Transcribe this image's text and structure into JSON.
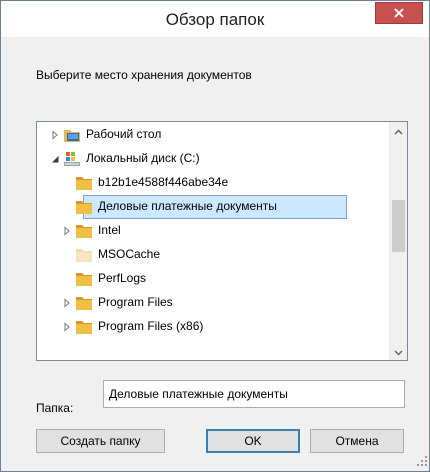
{
  "window": {
    "title": "Обзор папок"
  },
  "prompt": "Выберите место хранения документов",
  "tree": {
    "items": [
      {
        "label": "Рабочий стол",
        "icon": "desktop-folder-icon",
        "expander": "collapsed",
        "level": 0
      },
      {
        "label": "Локальный диск (C:)",
        "icon": "drive-icon",
        "expander": "expanded",
        "level": 0
      },
      {
        "label": "b12b1e4588f446abe34e",
        "icon": "folder-icon",
        "expander": "none",
        "level": 1
      },
      {
        "label": "Деловые платежные документы",
        "icon": "folder-icon",
        "expander": "none",
        "level": 1,
        "selected": true
      },
      {
        "label": "Intel",
        "icon": "folder-icon",
        "expander": "collapsed",
        "level": 1
      },
      {
        "label": "MSOCache",
        "icon": "folder-hidden-icon",
        "expander": "none",
        "level": 1
      },
      {
        "label": "PerfLogs",
        "icon": "folder-icon",
        "expander": "none",
        "level": 1
      },
      {
        "label": "Program Files",
        "icon": "folder-icon",
        "expander": "collapsed",
        "level": 1
      },
      {
        "label": "Program Files (x86)",
        "icon": "folder-icon",
        "expander": "collapsed",
        "level": 1
      }
    ]
  },
  "folder_field": {
    "label": "Папка:",
    "value": "Деловые платежные документы"
  },
  "buttons": {
    "new_folder": "Создать папку",
    "ok": "OK",
    "cancel": "Отмена"
  },
  "colors": {
    "selection_bg": "#cce8ff",
    "selection_border": "#7da2ce",
    "close_button": "#c7514e",
    "folder_yellow": "#e8b84a"
  }
}
